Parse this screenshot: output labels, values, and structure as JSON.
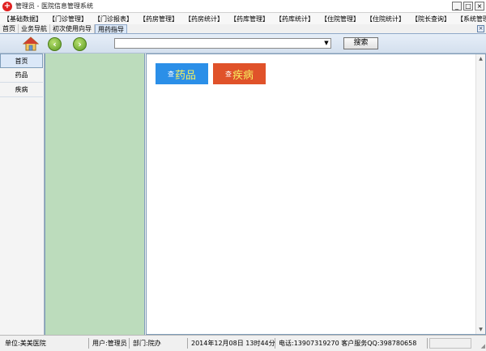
{
  "window": {
    "title": "管理员 - 医院信息管理系统",
    "app_icon": "medical-cross-icon",
    "controls": [
      "_",
      "□",
      "×"
    ]
  },
  "menu": [
    "【基础数据】",
    "【门诊管理】",
    "【门诊报表】",
    "【药房管理】",
    "【药房统计】",
    "【药库管理】",
    "【药库统计】",
    "【住院管理】",
    "【住院统计】",
    "【院长查询】",
    "【系统管理】"
  ],
  "tabs": [
    {
      "label": "首页"
    },
    {
      "label": "业务导航"
    },
    {
      "label": "初次使用向导"
    },
    {
      "label": "用药指导"
    }
  ],
  "active_tab": "用药指导",
  "tab_close_label": "×",
  "toolbar": {
    "home_icon": "home-icon",
    "back_icon": "back-arrow-icon",
    "forward_icon": "forward-arrow-icon",
    "back_glyph": "‹",
    "forward_glyph": "›",
    "address_value": "",
    "dropdown_glyph": "▼",
    "search_label": "搜索"
  },
  "left_nav": [
    {
      "label": "首页"
    },
    {
      "label": "药品"
    },
    {
      "label": "疾病"
    }
  ],
  "quick_buttons": {
    "drug": {
      "prefix": "查",
      "label": "药品",
      "color": "#2b8fe8"
    },
    "disease": {
      "prefix": "查",
      "label": "疾病",
      "color": "#e0522a"
    }
  },
  "scroll_glyphs": {
    "up": "▲",
    "down": "▼"
  },
  "status": {
    "unit": "单位:美美医院",
    "user": "用户:管理员",
    "dept": "部门:院办",
    "datetime": "2014年12月08日 13时44分",
    "contact": "电话:13907319270 客户服务QQ:398780658"
  },
  "colors": {
    "accent": "#dbe8f8",
    "mid_panel": "#bcdcbc",
    "highlight_text": "#f6f060"
  }
}
